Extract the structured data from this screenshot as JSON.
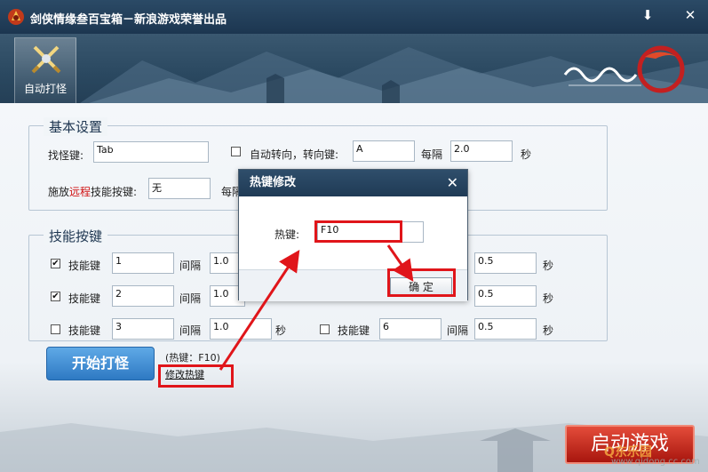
{
  "window": {
    "title": "剑侠情缘叁百宝箱－新浪游戏荣誉出品",
    "minimize": "⬇",
    "close": "✕"
  },
  "nav": {
    "tab_label": "自动打怪"
  },
  "basic": {
    "legend": "基本设置",
    "target_key_label": "找怪键:",
    "target_key_value": "Tab",
    "auto_turn_label": "自动转向，转向键:",
    "auto_turn_checked": false,
    "turn_key_value": "A",
    "interval_label": "每隔",
    "interval_value": "2.0",
    "sec_label": "秒",
    "ranged_prefix": "施放",
    "ranged_red": "远程",
    "ranged_suffix": "技能按键:",
    "ranged_value": "无",
    "ranged_interval_label": "每隔"
  },
  "skills": {
    "legend": "技能按键",
    "key_label": "技能键",
    "interval_label": "间隔",
    "sec_label": "秒",
    "left": [
      {
        "checked": true,
        "key": "1",
        "interval": "1.0"
      },
      {
        "checked": true,
        "key": "2",
        "interval": "1.0"
      },
      {
        "checked": false,
        "key": "3",
        "interval": "1.0"
      }
    ],
    "right": [
      {
        "interval": "0.5"
      },
      {
        "interval": "0.5"
      },
      {
        "checked": false,
        "key": "6",
        "interval": "0.5"
      }
    ]
  },
  "actions": {
    "start_label": "开始打怪",
    "hotkey_info": "(热键：F10)",
    "edit_hotkey": "修改热键",
    "launch_label": "启动游戏"
  },
  "dialog": {
    "title": "热键修改",
    "close": "✕",
    "hotkey_label": "热键:",
    "hotkey_value": "F10",
    "ok_label": "确  定"
  },
  "check_mark": "✔",
  "watermark": {
    "line1": "Q东乐园",
    "line2": "www.qidong.cc.com"
  }
}
